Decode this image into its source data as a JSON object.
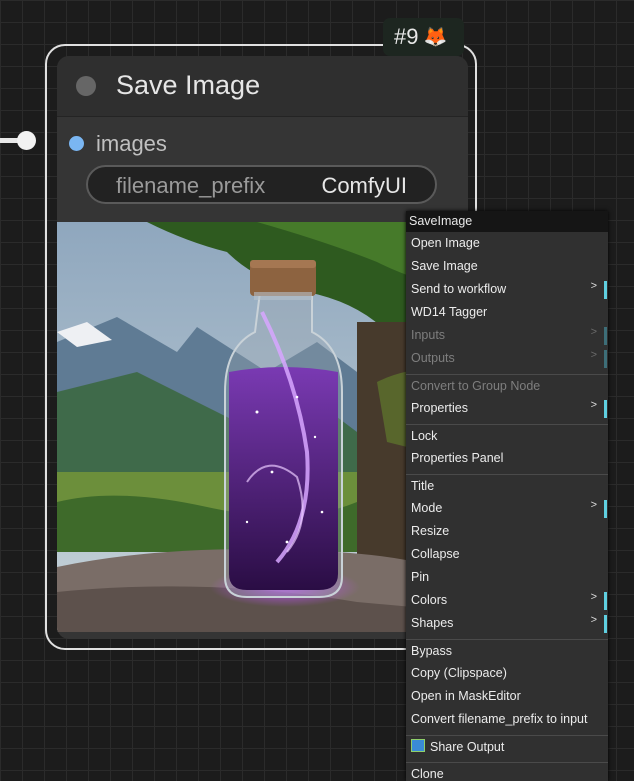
{
  "node": {
    "badge_text": "#9",
    "badge_icon": "🦊",
    "title": "Save Image",
    "input_slot": "images",
    "widget": {
      "name": "filename_prefix",
      "value": "ComfyUI"
    },
    "colors": {
      "slot_images": "#7ab6f2",
      "selection_outline": "#e0e0e0"
    }
  },
  "context_menu": {
    "title": "SaveImage",
    "items": [
      {
        "label": "Open Image",
        "disabled": false,
        "submenu": false
      },
      {
        "label": "Save Image",
        "disabled": false,
        "submenu": false
      },
      {
        "label": "Send to workflow",
        "disabled": false,
        "submenu": true
      },
      {
        "label": "WD14 Tagger",
        "disabled": false,
        "submenu": false
      },
      {
        "label": "Inputs",
        "disabled": true,
        "submenu": true
      },
      {
        "label": "Outputs",
        "disabled": true,
        "submenu": true
      },
      {
        "label": "Convert to Group Node",
        "disabled": true,
        "submenu": false
      },
      {
        "label": "Properties",
        "disabled": false,
        "submenu": true
      },
      {
        "label": "Lock",
        "disabled": false,
        "submenu": false
      },
      {
        "label": "Properties Panel",
        "disabled": false,
        "submenu": false
      },
      {
        "label": "Title",
        "disabled": false,
        "submenu": false
      },
      {
        "label": "Mode",
        "disabled": false,
        "submenu": true
      },
      {
        "label": "Resize",
        "disabled": false,
        "submenu": false
      },
      {
        "label": "Collapse",
        "disabled": false,
        "submenu": false
      },
      {
        "label": "Pin",
        "disabled": false,
        "submenu": false
      },
      {
        "label": "Colors",
        "disabled": false,
        "submenu": true
      },
      {
        "label": "Shapes",
        "disabled": false,
        "submenu": true
      },
      {
        "label": "Bypass",
        "disabled": false,
        "submenu": false
      },
      {
        "label": "Copy (Clipspace)",
        "disabled": false,
        "submenu": false
      },
      {
        "label": "Open in MaskEditor",
        "disabled": false,
        "submenu": false
      },
      {
        "label": "Convert filename_prefix to input",
        "disabled": false,
        "submenu": false
      },
      {
        "label": "Share Output",
        "disabled": false,
        "submenu": false,
        "icon": "share-image-icon"
      },
      {
        "label": "Clone",
        "disabled": false,
        "submenu": false
      }
    ],
    "submenu_arrow": ">"
  }
}
